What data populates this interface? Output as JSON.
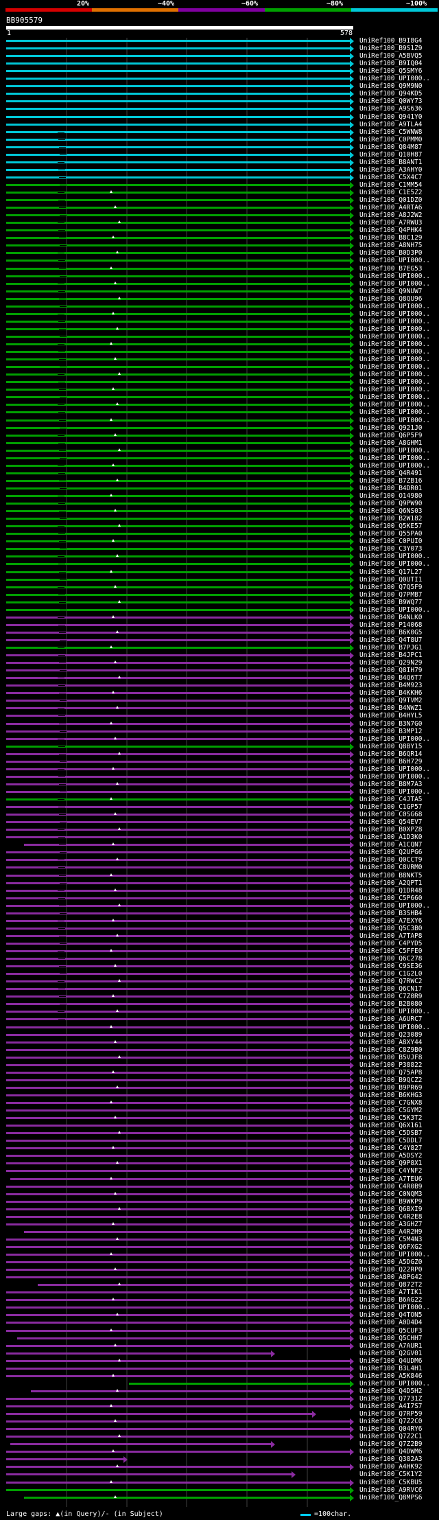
{
  "legend": {
    "labels": [
      "20%",
      "~40%",
      "~60%",
      "~80%",
      "~100%"
    ],
    "colors": [
      "#d60000",
      "#e07000",
      "#8000a0",
      "#00a000",
      "#00c8d8"
    ]
  },
  "query": {
    "id": "BB905579",
    "start": "1",
    "end": "578"
  },
  "footer": {
    "gaps_text": "Large gaps: ▲(in Query)/- (in Subject)",
    "scale_text": "=100char."
  },
  "hits": [
    {
      "label": "UniRef100_B9I8G4",
      "color": "cyan"
    },
    {
      "label": "UniRef100_B9S1Z9",
      "color": "cyan"
    },
    {
      "label": "UniRef100_A5BVQ5",
      "color": "cyan"
    },
    {
      "label": "UniRef100_B9IQ04",
      "color": "cyan"
    },
    {
      "label": "UniRef100_Q5SMY6",
      "color": "cyan"
    },
    {
      "label": "UniRef100_UPI000..",
      "color": "cyan"
    },
    {
      "label": "UniRef100_Q9M9N0",
      "color": "cyan"
    },
    {
      "label": "UniRef100_Q94KD5",
      "color": "cyan"
    },
    {
      "label": "UniRef100_Q0WY73",
      "color": "cyan"
    },
    {
      "label": "UniRef100_A9S636",
      "color": "cyan"
    },
    {
      "label": "UniRef100_Q941Y0",
      "color": "cyan"
    },
    {
      "label": "UniRef100_A9TLA4",
      "color": "cyan"
    },
    {
      "label": "UniRef100_C5WNW8",
      "color": "cyan"
    },
    {
      "label": "UniRef100_C0PMM0",
      "color": "cyan"
    },
    {
      "label": "UniRef100_Q84M87",
      "color": "cyan"
    },
    {
      "label": "UniRef100_Q10H87",
      "color": "cyan"
    },
    {
      "label": "UniRef100_B8ANT1",
      "color": "cyan"
    },
    {
      "label": "UniRef100_A3AHY0",
      "color": "cyan"
    },
    {
      "label": "UniRef100_C5X4C7",
      "color": "cyan"
    },
    {
      "label": "UniRef100_C1MM54",
      "color": "green"
    },
    {
      "label": "UniRef100_C1E5Z2",
      "color": "green"
    },
    {
      "label": "UniRef100_Q01DZ0",
      "color": "green"
    },
    {
      "label": "UniRef100_A4RTA6",
      "color": "green"
    },
    {
      "label": "UniRef100_A8J2W2",
      "color": "green"
    },
    {
      "label": "UniRef100_A7RWU3",
      "color": "green"
    },
    {
      "label": "UniRef100_Q4PHK4",
      "color": "green"
    },
    {
      "label": "UniRef100_B8C129",
      "color": "green"
    },
    {
      "label": "UniRef100_A8NH75",
      "color": "green"
    },
    {
      "label": "UniRef100_B0D3P0",
      "color": "green"
    },
    {
      "label": "UniRef100_UPI000..",
      "color": "green"
    },
    {
      "label": "UniRef100_B7EG53",
      "color": "green"
    },
    {
      "label": "UniRef100_UPI000..",
      "color": "green"
    },
    {
      "label": "UniRef100_UPI000..",
      "color": "green"
    },
    {
      "label": "UniRef100_Q9NUW7",
      "color": "green"
    },
    {
      "label": "UniRef100_Q8QU96",
      "color": "green"
    },
    {
      "label": "UniRef100_UPI000..",
      "color": "green"
    },
    {
      "label": "UniRef100_UPI000..",
      "color": "green"
    },
    {
      "label": "UniRef100_UPI000..",
      "color": "green"
    },
    {
      "label": "UniRef100_UPI000..",
      "color": "green"
    },
    {
      "label": "UniRef100_UPI000..",
      "color": "green"
    },
    {
      "label": "UniRef100_UPI000..",
      "color": "green"
    },
    {
      "label": "UniRef100_UPI000..",
      "color": "green"
    },
    {
      "label": "UniRef100_UPI000..",
      "color": "green"
    },
    {
      "label": "UniRef100_UPI000..",
      "color": "green"
    },
    {
      "label": "UniRef100_UPI000..",
      "color": "green"
    },
    {
      "label": "UniRef100_UPI000..",
      "color": "green"
    },
    {
      "label": "UniRef100_UPI000..",
      "color": "green"
    },
    {
      "label": "UniRef100_UPI000..",
      "color": "green"
    },
    {
      "label": "UniRef100_UPI000..",
      "color": "green"
    },
    {
      "label": "UniRef100_UPI000..",
      "color": "green"
    },
    {
      "label": "UniRef100_UPI000..",
      "color": "green"
    },
    {
      "label": "UniRef100_Q921J0",
      "color": "green"
    },
    {
      "label": "UniRef100_Q6P5F9",
      "color": "green"
    },
    {
      "label": "UniRef100_A8GHM1",
      "color": "green"
    },
    {
      "label": "UniRef100_UPI000..",
      "color": "green"
    },
    {
      "label": "UniRef100_UPI000..",
      "color": "green"
    },
    {
      "label": "UniRef100_UPI000..",
      "color": "green"
    },
    {
      "label": "UniRef100_Q4R491",
      "color": "green"
    },
    {
      "label": "UniRef100_B7ZB16",
      "color": "green"
    },
    {
      "label": "UniRef100_B4DR01",
      "color": "green"
    },
    {
      "label": "UniRef100_O14980",
      "color": "green"
    },
    {
      "label": "UniRef100_Q9PW90",
      "color": "green"
    },
    {
      "label": "UniRef100_Q6NS03",
      "color": "green"
    },
    {
      "label": "UniRef100_B2W182",
      "color": "green"
    },
    {
      "label": "UniRef100_Q5KE57",
      "color": "green"
    },
    {
      "label": "UniRef100_Q55PA0",
      "color": "green"
    },
    {
      "label": "UniRef100_C0PUI0",
      "color": "green"
    },
    {
      "label": "UniRef100_C3Y073",
      "color": "green"
    },
    {
      "label": "UniRef100_UPI000..",
      "color": "green"
    },
    {
      "label": "UniRef100_UPI000..",
      "color": "green"
    },
    {
      "label": "UniRef100_Q17L27",
      "color": "green"
    },
    {
      "label": "UniRef100_Q0UTI1",
      "color": "green"
    },
    {
      "label": "UniRef100_Q7Q5F9",
      "color": "green"
    },
    {
      "label": "UniRef100_Q7PMB7",
      "color": "green"
    },
    {
      "label": "UniRef100_B9WQ77",
      "color": "green"
    },
    {
      "label": "UniRef100_UPI000..",
      "color": "green"
    },
    {
      "label": "UniRef100_B4NLK0",
      "color": "purple"
    },
    {
      "label": "UniRef100_P14068",
      "color": "purple"
    },
    {
      "label": "UniRef100_B6K0G5",
      "color": "purple"
    },
    {
      "label": "UniRef100_Q4T8U7",
      "color": "purple"
    },
    {
      "label": "UniRef100_B7PJG1",
      "color": "green"
    },
    {
      "label": "UniRef100_B4JPC1",
      "color": "purple"
    },
    {
      "label": "UniRef100_Q29N29",
      "color": "purple"
    },
    {
      "label": "UniRef100_Q8IH79",
      "color": "purple"
    },
    {
      "label": "UniRef100_B4Q6T7",
      "color": "purple"
    },
    {
      "label": "UniRef100_B4M923",
      "color": "purple"
    },
    {
      "label": "UniRef100_B4KKH6",
      "color": "purple"
    },
    {
      "label": "UniRef100_Q9TVM2",
      "color": "purple"
    },
    {
      "label": "UniRef100_B4NWZ1",
      "color": "purple"
    },
    {
      "label": "UniRef100_B4HYL5",
      "color": "purple"
    },
    {
      "label": "UniRef100_B3N7G0",
      "color": "purple"
    },
    {
      "label": "UniRef100_B3MP12",
      "color": "purple"
    },
    {
      "label": "UniRef100_UPI000..",
      "color": "purple"
    },
    {
      "label": "UniRef100_Q8BY15",
      "color": "green"
    },
    {
      "label": "UniRef100_B6QR14",
      "color": "purple"
    },
    {
      "label": "UniRef100_B6H729",
      "color": "purple"
    },
    {
      "label": "UniRef100_UPI000..",
      "color": "purple"
    },
    {
      "label": "UniRef100_UPI000..",
      "color": "purple"
    },
    {
      "label": "UniRef100_B8M7A3",
      "color": "purple"
    },
    {
      "label": "UniRef100_UPI000..",
      "color": "purple"
    },
    {
      "label": "UniRef100_C4JTA5",
      "color": "green"
    },
    {
      "label": "UniRef100_C1GP57",
      "color": "purple"
    },
    {
      "label": "UniRef100_C0SG68",
      "color": "purple"
    },
    {
      "label": "UniRef100_Q54EV7",
      "color": "purple"
    },
    {
      "label": "UniRef100_B0XPZ8",
      "color": "purple"
    },
    {
      "label": "UniRef100_A1D3K0",
      "color": "purple"
    },
    {
      "label": "UniRef100_A1CQN7",
      "color": "purple"
    },
    {
      "label": "UniRef100_Q2UPG6",
      "color": "purple"
    },
    {
      "label": "UniRef100_Q0CCT9",
      "color": "purple"
    },
    {
      "label": "UniRef100_C8VRM0",
      "color": "purple"
    },
    {
      "label": "UniRef100_B8NKT5",
      "color": "purple"
    },
    {
      "label": "UniRef100_A2QPT1",
      "color": "purple"
    },
    {
      "label": "UniRef100_Q1DR48",
      "color": "purple"
    },
    {
      "label": "UniRef100_C5P660",
      "color": "purple"
    },
    {
      "label": "UniRef100_UPI000..",
      "color": "purple"
    },
    {
      "label": "UniRef100_B3SHB4",
      "color": "purple"
    },
    {
      "label": "UniRef100_A7EXY6",
      "color": "purple"
    },
    {
      "label": "UniRef100_Q5C3B0",
      "color": "purple"
    },
    {
      "label": "UniRef100_A7TAP8",
      "color": "purple"
    },
    {
      "label": "UniRef100_C4PYD5",
      "color": "purple"
    },
    {
      "label": "UniRef100_C5FFE0",
      "color": "purple"
    },
    {
      "label": "UniRef100_Q6C278",
      "color": "purple"
    },
    {
      "label": "UniRef100_C9SE36",
      "color": "purple"
    },
    {
      "label": "UniRef100_C1G2L0",
      "color": "purple"
    },
    {
      "label": "UniRef100_Q7RWC2",
      "color": "purple"
    },
    {
      "label": "UniRef100_Q6CN17",
      "color": "purple"
    },
    {
      "label": "UniRef100_C7Z0R9",
      "color": "purple"
    },
    {
      "label": "UniRef100_B2B080",
      "color": "purple"
    },
    {
      "label": "UniRef100_UPI000..",
      "color": "purple"
    },
    {
      "label": "UniRef100_A6URC7",
      "color": "purple"
    },
    {
      "label": "UniRef100_UPI000..",
      "color": "purple"
    },
    {
      "label": "UniRef100_Q23089",
      "color": "purple"
    },
    {
      "label": "UniRef100_A8XY44",
      "color": "purple"
    },
    {
      "label": "UniRef100_C8Z9B0",
      "color": "purple"
    },
    {
      "label": "UniRef100_B5VJF8",
      "color": "purple"
    },
    {
      "label": "UniRef100_P38822",
      "color": "purple"
    },
    {
      "label": "UniRef100_Q75AP8",
      "color": "purple"
    },
    {
      "label": "UniRef100_B9QCZ2",
      "color": "purple"
    },
    {
      "label": "UniRef100_B9PR69",
      "color": "purple"
    },
    {
      "label": "UniRef100_B6KHG3",
      "color": "purple"
    },
    {
      "label": "UniRef100_C7GNX8",
      "color": "purple"
    },
    {
      "label": "UniRef100_C5GYM2",
      "color": "purple"
    },
    {
      "label": "UniRef100_C5K3T2",
      "color": "purple"
    },
    {
      "label": "UniRef100_Q6X161",
      "color": "purple"
    },
    {
      "label": "UniRef100_C5DSB7",
      "color": "purple"
    },
    {
      "label": "UniRef100_C5DDL7",
      "color": "purple"
    },
    {
      "label": "UniRef100_C4Y827",
      "color": "purple"
    },
    {
      "label": "UniRef100_A5DSY2",
      "color": "purple"
    },
    {
      "label": "UniRef100_Q9P8X1",
      "color": "purple"
    },
    {
      "label": "UniRef100_C4YNF2",
      "color": "purple"
    },
    {
      "label": "UniRef100_A7TEU6",
      "color": "purple"
    },
    {
      "label": "UniRef100_C4R0B9",
      "color": "purple"
    },
    {
      "label": "UniRef100_C0NQM3",
      "color": "purple"
    },
    {
      "label": "UniRef100_B9WKP9",
      "color": "purple"
    },
    {
      "label": "UniRef100_Q6BXI9",
      "color": "purple"
    },
    {
      "label": "UniRef100_C4R2E8",
      "color": "purple"
    },
    {
      "label": "UniRef100_A3GHZ7",
      "color": "purple"
    },
    {
      "label": "UniRef100_A4R2H9",
      "color": "purple"
    },
    {
      "label": "UniRef100_C5M4N3",
      "color": "purple"
    },
    {
      "label": "UniRef100_Q6FXG2",
      "color": "purple"
    },
    {
      "label": "UniRef100_UPI000..",
      "color": "purple"
    },
    {
      "label": "UniRef100_A5DGZ0",
      "color": "purple"
    },
    {
      "label": "UniRef100_Q22RP0",
      "color": "purple"
    },
    {
      "label": "UniRef100_A8PG42",
      "color": "purple"
    },
    {
      "label": "UniRef100_Q872T2",
      "color": "purple"
    },
    {
      "label": "UniRef100_A7TIK1",
      "color": "purple"
    },
    {
      "label": "UniRef100_B6AG22",
      "color": "purple"
    },
    {
      "label": "UniRef100_UPI000..",
      "color": "purple"
    },
    {
      "label": "UniRef100_Q4TON5",
      "color": "purple"
    },
    {
      "label": "UniRef100_A0D4D4",
      "color": "purple"
    },
    {
      "label": "UniRef100_Q5CUF3",
      "color": "purple"
    },
    {
      "label": "UniRef100_Q5CHH7",
      "color": "purple"
    },
    {
      "label": "UniRef100_A7AUR1",
      "color": "purple"
    },
    {
      "label": "UniRef100_Q2GV01",
      "color": "purple"
    },
    {
      "label": "UniRef100_Q4UDM6",
      "color": "purple"
    },
    {
      "label": "UniRef100_B3L4H1",
      "color": "purple"
    },
    {
      "label": "UniRef100_A5K846",
      "color": "purple"
    },
    {
      "label": "UniRef100_UPI000..",
      "color": "green"
    },
    {
      "label": "UniRef100_Q4D5H2",
      "color": "purple"
    },
    {
      "label": "UniRef100_Q7731Z",
      "color": "purple"
    },
    {
      "label": "UniRef100_A4I7S7",
      "color": "purple"
    },
    {
      "label": "UniRef100_Q7RP59",
      "color": "purple"
    },
    {
      "label": "UniRef100_Q7Z2C0",
      "color": "purple"
    },
    {
      "label": "UniRef100_Q04RY6",
      "color": "purple"
    },
    {
      "label": "UniRef100_Q7Z2C1",
      "color": "purple"
    },
    {
      "label": "UniRef100_Q7Z2B9",
      "color": "purple"
    },
    {
      "label": "UniRef100_Q4DWM6",
      "color": "purple"
    },
    {
      "label": "UniRef100_Q382A3",
      "color": "purple"
    },
    {
      "label": "UniRef100_A4HK92",
      "color": "purple"
    },
    {
      "label": "UniRef100_C5K1Y2",
      "color": "purple"
    },
    {
      "label": "UniRef100_C5KBU5",
      "color": "purple"
    },
    {
      "label": "UniRef100_A9RVC6",
      "color": "green"
    },
    {
      "label": "UniRef100_Q8MPS6",
      "color": "green"
    }
  ]
}
